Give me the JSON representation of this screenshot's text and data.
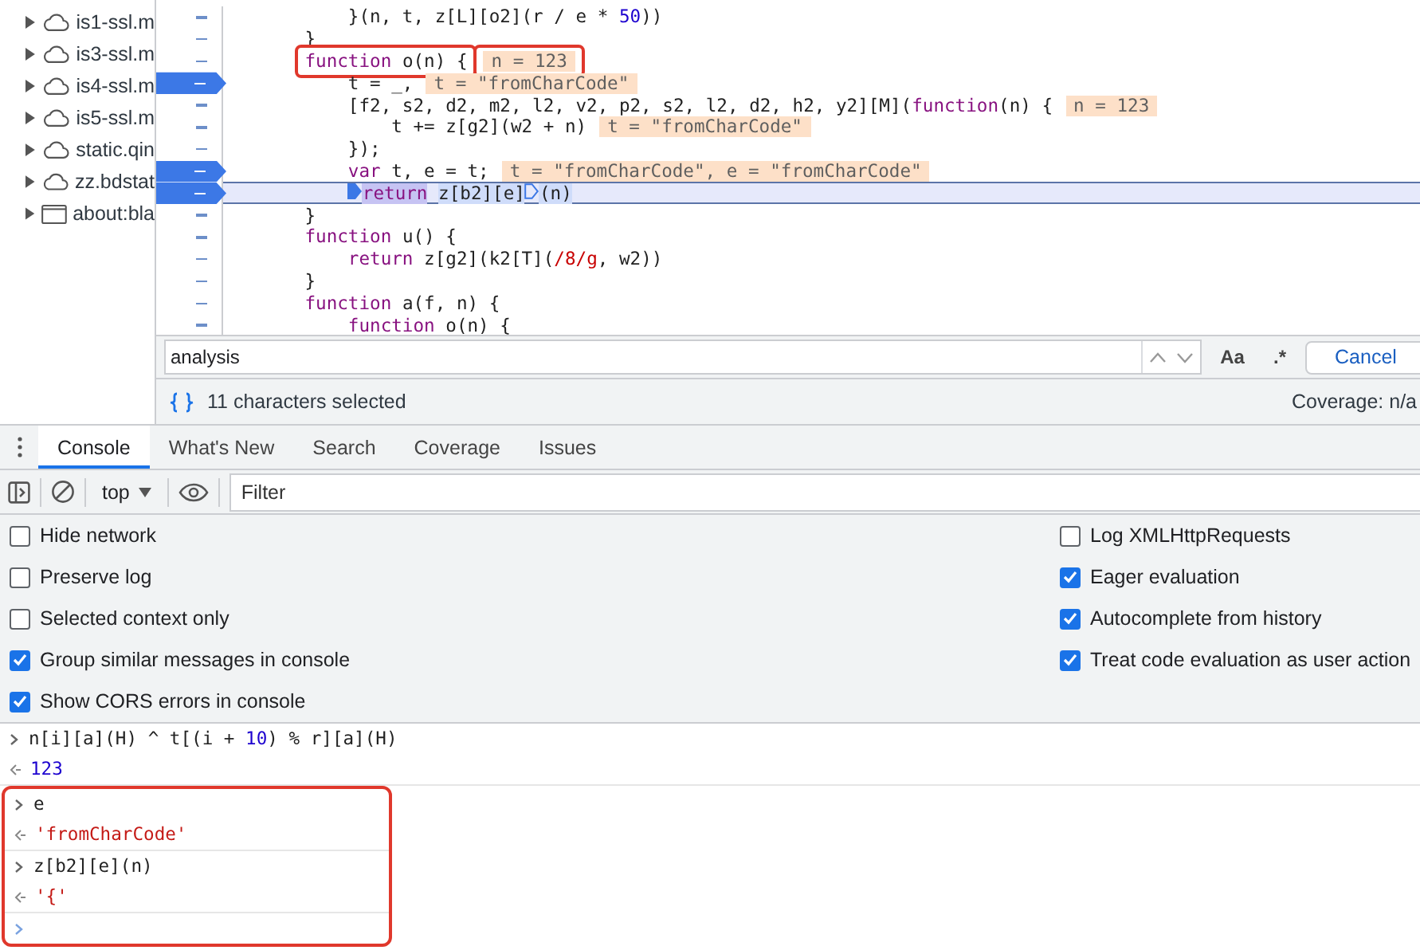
{
  "sidebar": {
    "items": [
      {
        "label": "is1-ssl.m",
        "kind": "host"
      },
      {
        "label": "is3-ssl.m",
        "kind": "host"
      },
      {
        "label": "is4-ssl.m",
        "kind": "host"
      },
      {
        "label": "is5-ssl.m",
        "kind": "host"
      },
      {
        "label": "static.qin",
        "kind": "host"
      },
      {
        "label": "zz.bdstat",
        "kind": "host"
      },
      {
        "label": "about:bla",
        "kind": "page"
      }
    ]
  },
  "editor": {
    "lines": [
      {
        "breakpoint": false,
        "current": false,
        "annotated": false,
        "code": [
          {
            "kind": "text",
            "text": "        }(n, t, z[L][o2](r / e * "
          },
          {
            "kind": "number",
            "text": "50"
          },
          {
            "kind": "text",
            "text": "))"
          }
        ]
      },
      {
        "breakpoint": false,
        "current": false,
        "annotated": false,
        "code": [
          {
            "kind": "text",
            "text": "    }"
          }
        ]
      },
      {
        "breakpoint": false,
        "current": false,
        "annotated": true,
        "code": [
          {
            "kind": "keyword",
            "text": "function"
          },
          {
            "kind": "text",
            "text": " o(n) {"
          }
        ],
        "inline_value": "n = 123"
      },
      {
        "breakpoint": true,
        "current": false,
        "annotated": false,
        "code": [
          {
            "kind": "text",
            "text": "        t = _,"
          }
        ],
        "inline_value": "t = \"fromCharCode\""
      },
      {
        "breakpoint": false,
        "current": false,
        "annotated": false,
        "code": [
          {
            "kind": "text",
            "text": "        [f2, s2, d2, m2, l2, v2, p2, s2, l2, d2, h2, y2][M]("
          },
          {
            "kind": "keyword",
            "text": "function"
          },
          {
            "kind": "text",
            "text": "(n) {"
          }
        ],
        "inline_value": "n = 123"
      },
      {
        "breakpoint": false,
        "current": false,
        "annotated": false,
        "code": [
          {
            "kind": "text",
            "text": "            t += z[g2](w2 + n)"
          }
        ],
        "inline_value": "t = \"fromCharCode\""
      },
      {
        "breakpoint": false,
        "current": false,
        "annotated": false,
        "code": [
          {
            "kind": "text",
            "text": "        });"
          }
        ]
      },
      {
        "breakpoint": true,
        "current": false,
        "annotated": false,
        "code": [
          {
            "kind": "keyword",
            "text": "        var"
          },
          {
            "kind": "text",
            "text": " t, e = t;"
          }
        ],
        "inline_value": "t = \"fromCharCode\", e = \"fromCharCode\""
      },
      {
        "breakpoint": true,
        "current": true,
        "annotated": false,
        "code": [
          {
            "kind": "keyword",
            "text": "        return",
            "paused": true,
            "highlighted": true
          },
          {
            "kind": "text",
            "text": " z[b2][e]",
            "highlighted": true,
            "call_marker": true
          },
          {
            "kind": "text",
            "text": "(n)",
            "highlighted": true
          }
        ]
      },
      {
        "breakpoint": false,
        "current": false,
        "annotated": false,
        "code": [
          {
            "kind": "text",
            "text": "    }"
          }
        ]
      },
      {
        "breakpoint": false,
        "current": false,
        "annotated": false,
        "code": [
          {
            "kind": "keyword",
            "text": "    function"
          },
          {
            "kind": "text",
            "text": " u() {"
          }
        ]
      },
      {
        "breakpoint": false,
        "current": false,
        "annotated": false,
        "code": [
          {
            "kind": "keyword",
            "text": "        return"
          },
          {
            "kind": "text",
            "text": " z[g2](k2[T]("
          },
          {
            "kind": "regex",
            "text": "/8/g"
          },
          {
            "kind": "text",
            "text": ", w2))"
          }
        ]
      },
      {
        "breakpoint": false,
        "current": false,
        "annotated": false,
        "code": [
          {
            "kind": "text",
            "text": "    }"
          }
        ]
      },
      {
        "breakpoint": false,
        "current": false,
        "annotated": false,
        "code": [
          {
            "kind": "keyword",
            "text": "    function"
          },
          {
            "kind": "text",
            "text": " a(f, n) {"
          }
        ]
      },
      {
        "breakpoint": false,
        "current": false,
        "annotated": false,
        "code": [
          {
            "kind": "keyword",
            "text": "        function"
          },
          {
            "kind": "text",
            "text": " o(n) {"
          }
        ]
      }
    ]
  },
  "find_bar": {
    "value": "analysis",
    "match_case": "Aa",
    "regex": ".*",
    "cancel": "Cancel"
  },
  "status_bar": {
    "selection": "11 characters selected",
    "coverage": "Coverage: n/a"
  },
  "drawer_tabs": [
    {
      "label": "Console",
      "selected": true
    },
    {
      "label": "What's New",
      "selected": false
    },
    {
      "label": "Search",
      "selected": false
    },
    {
      "label": "Coverage",
      "selected": false
    },
    {
      "label": "Issues",
      "selected": false
    }
  ],
  "console_toolbar": {
    "context": "top",
    "filter_placeholder": "Filter"
  },
  "settings": {
    "left": [
      {
        "label": "Hide network",
        "checked": false
      },
      {
        "label": "Preserve log",
        "checked": false
      },
      {
        "label": "Selected context only",
        "checked": false
      },
      {
        "label": "Group similar messages in console",
        "checked": true
      },
      {
        "label": "Show CORS errors in console",
        "checked": true
      }
    ],
    "right": [
      {
        "label": "Log XMLHttpRequests",
        "checked": false
      },
      {
        "label": "Eager evaluation",
        "checked": true
      },
      {
        "label": "Autocomplete from history",
        "checked": true
      },
      {
        "label": "Treat code evaluation as user action",
        "checked": true
      }
    ]
  },
  "console": {
    "messages": [
      {
        "kind": "exchange",
        "annotated": false,
        "input": [
          {
            "kind": "text",
            "text": "n[i][a](H) ^ t[(i + "
          },
          {
            "kind": "number",
            "text": "10"
          },
          {
            "kind": "text",
            "text": ") % r][a](H)"
          }
        ],
        "output": {
          "kind": "number",
          "text": "123"
        }
      },
      {
        "kind": "exchange",
        "annotated": true,
        "input": [
          {
            "kind": "text",
            "text": "e"
          }
        ],
        "output": {
          "kind": "string",
          "text": "'fromCharCode'"
        }
      },
      {
        "kind": "exchange",
        "annotated": true,
        "input": [
          {
            "kind": "text",
            "text": "z[b2][e](n)"
          }
        ],
        "output": {
          "kind": "string",
          "text": "'{'"
        }
      },
      {
        "kind": "prompt",
        "annotated": true
      }
    ]
  }
}
